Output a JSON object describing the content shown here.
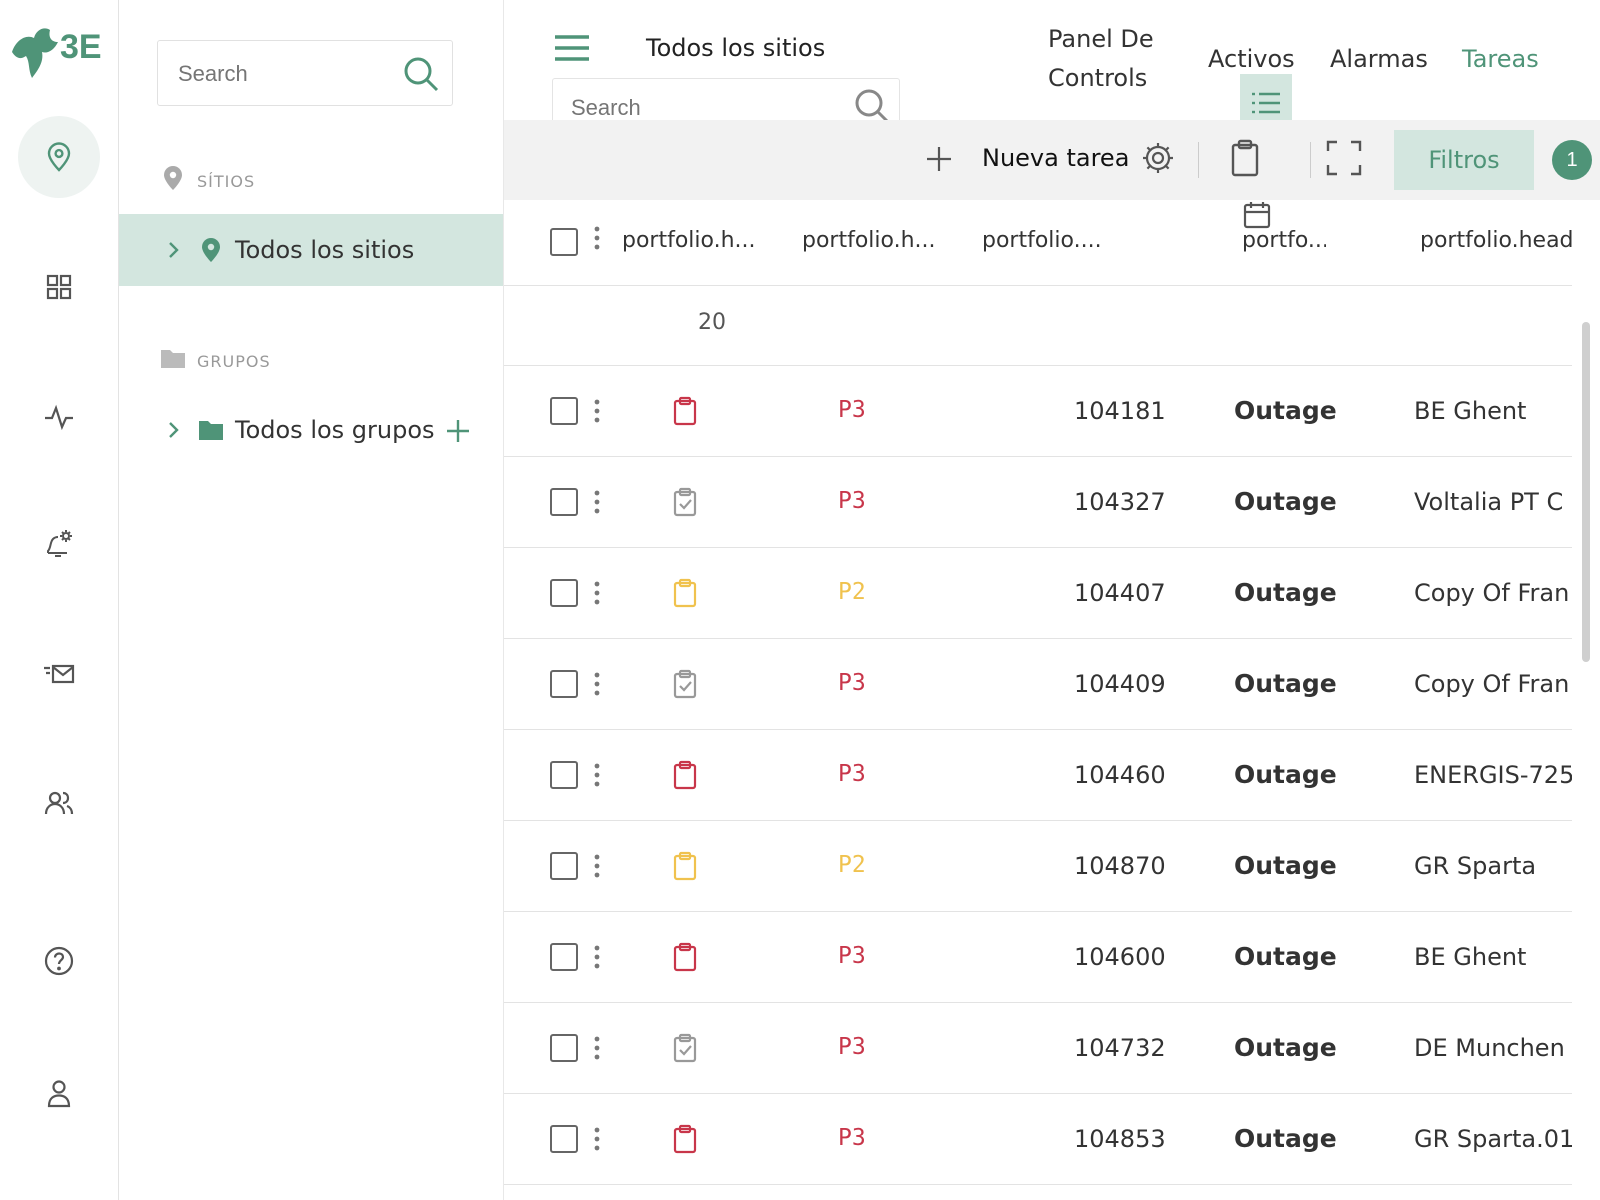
{
  "brand": {
    "logo_text": "3E",
    "colors": {
      "accent": "#4f9478",
      "accent_light": "#d3e6df",
      "red": "#c8364a",
      "yellow": "#f0c24e",
      "gray": "#888888"
    }
  },
  "rail": {
    "items": [
      {
        "name": "sites-nav",
        "icon": "location-pin-icon",
        "active": true
      },
      {
        "name": "dashboards-nav",
        "icon": "grid-icon",
        "active": false
      },
      {
        "name": "activity-nav",
        "icon": "pulse-icon",
        "active": false
      },
      {
        "name": "alarm-settings-nav",
        "icon": "bell-gear-icon",
        "active": false
      },
      {
        "name": "messages-nav",
        "icon": "mail-icon",
        "active": false
      },
      {
        "name": "users-nav",
        "icon": "users-icon",
        "active": false
      },
      {
        "name": "help-nav",
        "icon": "help-icon",
        "active": false
      },
      {
        "name": "profile-nav",
        "icon": "user-icon",
        "active": false
      }
    ]
  },
  "tree": {
    "search_placeholder": "Search",
    "sites_label": "SÍTIOS",
    "all_sites": "Todos los sitios",
    "groups_label": "GRUPOS",
    "all_groups": "Todos los grupos"
  },
  "header": {
    "breadcrumb": "Todos los sitios",
    "nav": {
      "dashboard_line1": "Panel De",
      "dashboard_line2": "Controls",
      "assets": "Activos",
      "alarms": "Alarmas",
      "tasks": "Tareas"
    },
    "search_placeholder": "Search"
  },
  "toolbar": {
    "new_task": "Nueva tarea",
    "filters": "Filtros",
    "filter_count": "1"
  },
  "table": {
    "headers": [
      "portfolio.h...",
      "portfolio.h...",
      "portfolio....",
      "portfo...",
      "portfolio.head"
    ],
    "page_size": "20",
    "rows": [
      {
        "status": "open",
        "status_color": "#c8364a",
        "priority": "P3",
        "priority_color": "#c8364a",
        "id": "104181",
        "type": "Outage",
        "site": "BE Ghent"
      },
      {
        "status": "done",
        "status_color": "#999999",
        "priority": "P3",
        "priority_color": "#c8364a",
        "id": "104327",
        "type": "Outage",
        "site": "Voltalia PT C"
      },
      {
        "status": "open",
        "status_color": "#f0c24e",
        "priority": "P2",
        "priority_color": "#f0c24e",
        "id": "104407",
        "type": "Outage",
        "site": "Copy Of Fran"
      },
      {
        "status": "done",
        "status_color": "#999999",
        "priority": "P3",
        "priority_color": "#c8364a",
        "id": "104409",
        "type": "Outage",
        "site": "Copy Of Fran"
      },
      {
        "status": "open",
        "status_color": "#c8364a",
        "priority": "P3",
        "priority_color": "#c8364a",
        "id": "104460",
        "type": "Outage",
        "site": "ENERGIS-725"
      },
      {
        "status": "open",
        "status_color": "#f0c24e",
        "priority": "P2",
        "priority_color": "#f0c24e",
        "id": "104870",
        "type": "Outage",
        "site": "GR Sparta"
      },
      {
        "status": "open",
        "status_color": "#c8364a",
        "priority": "P3",
        "priority_color": "#c8364a",
        "id": "104600",
        "type": "Outage",
        "site": "BE Ghent"
      },
      {
        "status": "done",
        "status_color": "#999999",
        "priority": "P3",
        "priority_color": "#c8364a",
        "id": "104732",
        "type": "Outage",
        "site": "DE Munchen"
      },
      {
        "status": "open",
        "status_color": "#c8364a",
        "priority": "P3",
        "priority_color": "#c8364a",
        "id": "104853",
        "type": "Outage",
        "site": "GR Sparta.01"
      }
    ]
  }
}
